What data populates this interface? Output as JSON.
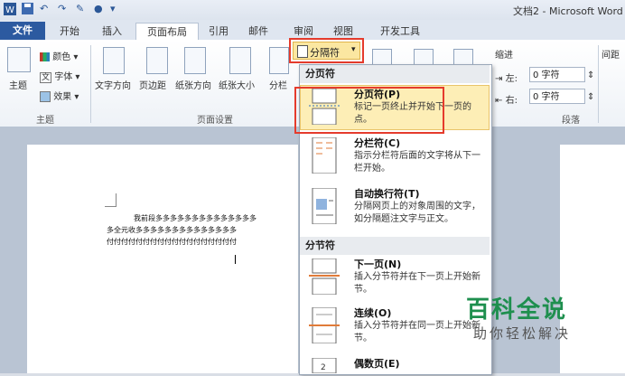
{
  "window": {
    "title": "文档2 - Microsoft Word"
  },
  "tabs": [
    {
      "label": "文件"
    },
    {
      "label": "开始"
    },
    {
      "label": "插入"
    },
    {
      "label": "页面布局"
    },
    {
      "label": "引用"
    },
    {
      "label": "邮件"
    },
    {
      "label": "审阅"
    },
    {
      "label": "视图"
    },
    {
      "label": "开发工具"
    }
  ],
  "ribbon": {
    "theme_group": {
      "label": "主题",
      "themes": "主题",
      "colors": "颜色",
      "fonts": "字体",
      "effects": "效果"
    },
    "page_setup_group": {
      "label": "页面设置",
      "text_direction": "文字方向",
      "margins": "页边距",
      "orientation": "纸张方向",
      "size": "纸张大小",
      "columns": "分栏",
      "breaks": "分隔符"
    },
    "paragraph_group": {
      "label": "段落",
      "indent": "缩进",
      "left_label": "左:",
      "left_value": "0 字符",
      "right_label": "右:",
      "right_value": "0 字符",
      "spacing": "间距"
    }
  },
  "document": {
    "line1": "我前段多多多多多多多多多多多多多多",
    "line2": "多全元收多多多多多多多多多多多多多多",
    "line3": "付付付付付付付付付付付付付付付付付付"
  },
  "menu": {
    "section_page_breaks": "分页符",
    "section_section_breaks": "分节符",
    "items": [
      {
        "title": "分页符(P)",
        "desc": "标记一页终止并开始下一页的点。"
      },
      {
        "title": "分栏符(C)",
        "desc": "指示分栏符后面的文字将从下一栏开始。"
      },
      {
        "title": "自动换行符(T)",
        "desc": "分隔网页上的对象周围的文字，如分隔题注文字与正文。"
      },
      {
        "title": "下一页(N)",
        "desc": "插入分节符并在下一页上开始新节。"
      },
      {
        "title": "连续(O)",
        "desc": "插入分节符并在同一页上开始新节。"
      },
      {
        "title": "偶数页(E)",
        "desc": ""
      }
    ]
  },
  "watermark": {
    "main": "百科全说",
    "sub": "助你轻松解决"
  },
  "colors": {
    "file_tab": "#2c5aa0",
    "highlight_red": "#e53b2c",
    "menu_hover": "#fdeeb6",
    "watermark_green": "#1e8f4e"
  }
}
